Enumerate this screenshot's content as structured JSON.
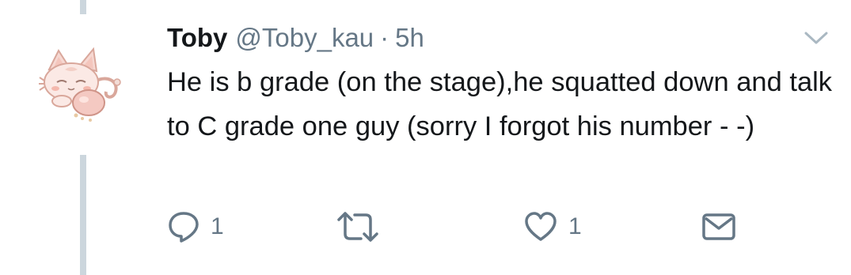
{
  "tweet": {
    "display_name": "Toby",
    "handle": "@Toby_kau",
    "separator": "·",
    "time": "5h",
    "text": "He is b grade (on the stage),he squatted down and talk to C grade one guy (sorry I forgot his number - -)"
  },
  "actions": {
    "reply_icon": "reply-icon",
    "reply_count": "1",
    "retweet_icon": "retweet-icon",
    "like_icon": "heart-icon",
    "like_count": "1",
    "dm_icon": "envelope-icon"
  },
  "colors": {
    "text": "#14171a",
    "secondary": "#657786",
    "thread_line": "#ccd6dd"
  }
}
